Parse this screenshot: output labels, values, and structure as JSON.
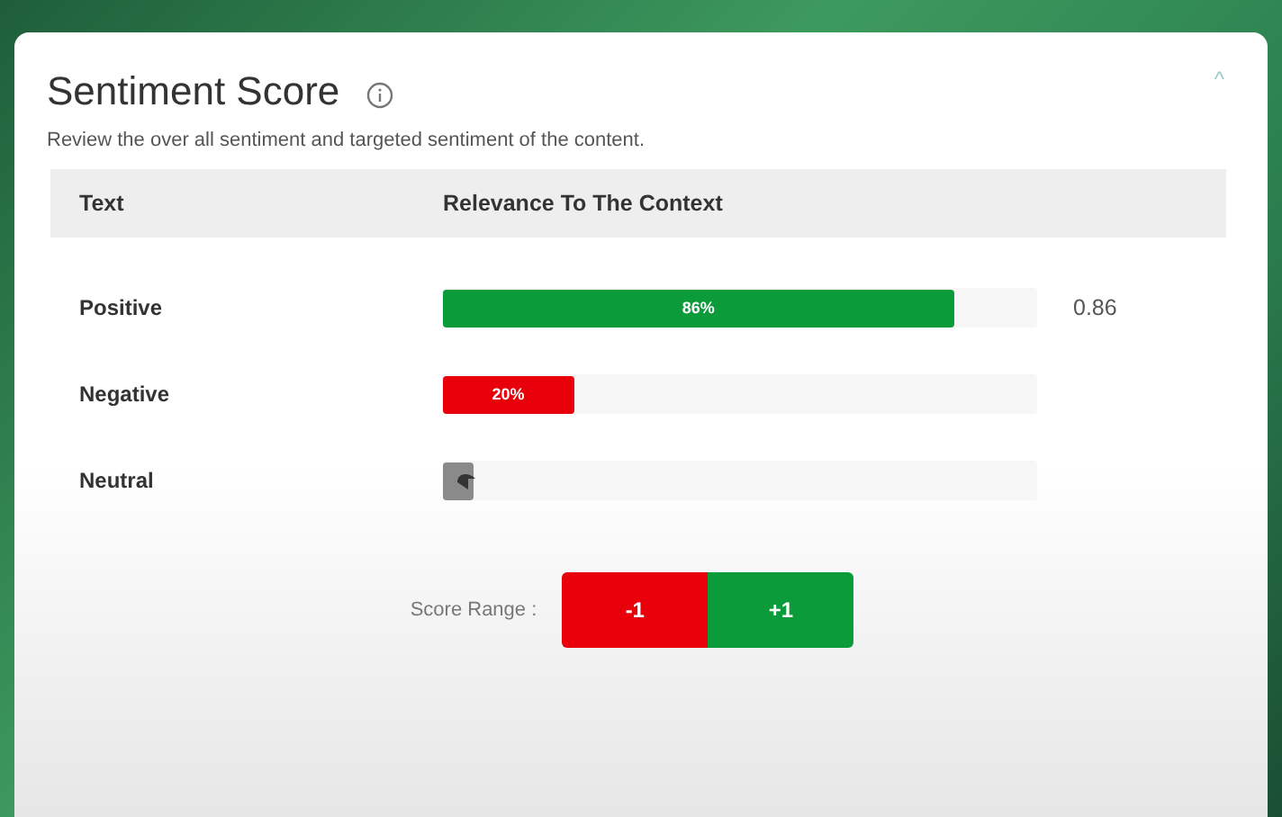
{
  "card": {
    "title": "Sentiment Score",
    "description": "Review the over all sentiment and targeted sentiment of the content.",
    "collapse_icon": "^"
  },
  "table": {
    "columns": [
      "Text",
      "Relevance To The Context"
    ],
    "rows": [
      {
        "label": "Positive",
        "level": 0.86,
        "bar_text": "86%",
        "color": "#0c9b3a",
        "score": "0.86"
      },
      {
        "label": "Negative",
        "level": 0.22,
        "bar_text": "20%",
        "color": "#e8000b"
      },
      {
        "label": "Neutral",
        "level": 0.05,
        "color": "#8a8a8a"
      }
    ]
  },
  "score_range": {
    "label": "Score Range :",
    "buttons": [
      {
        "label": "-1",
        "color": "#e8000b"
      },
      {
        "label": "+1",
        "color": "#0c9b3a"
      }
    ]
  }
}
